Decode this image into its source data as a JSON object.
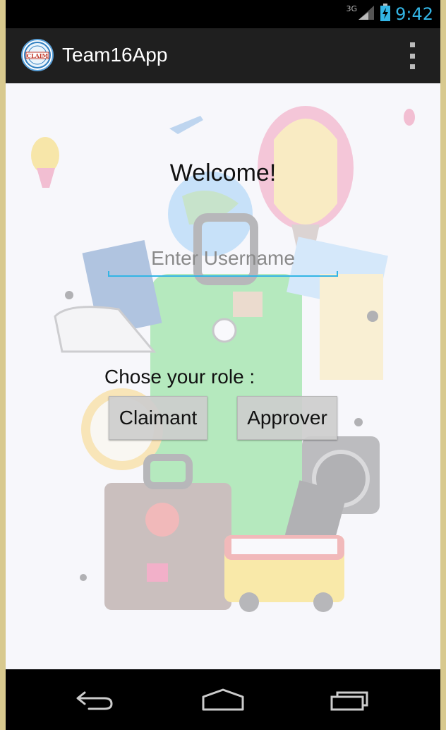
{
  "status_bar": {
    "network": "3G",
    "time": "9:42"
  },
  "action_bar": {
    "title": "Team16App",
    "logo_text": "CLAIM"
  },
  "content": {
    "welcome": "Welcome!",
    "username": {
      "value": "",
      "placeholder": "Enter Username"
    },
    "role_prompt": "Chose your role :",
    "buttons": {
      "claimant": "Claimant",
      "approver": "Approver"
    }
  },
  "colors": {
    "accent": "#33b5e5",
    "action_bar": "#1f1f1f",
    "frame": "#d8c98e"
  }
}
